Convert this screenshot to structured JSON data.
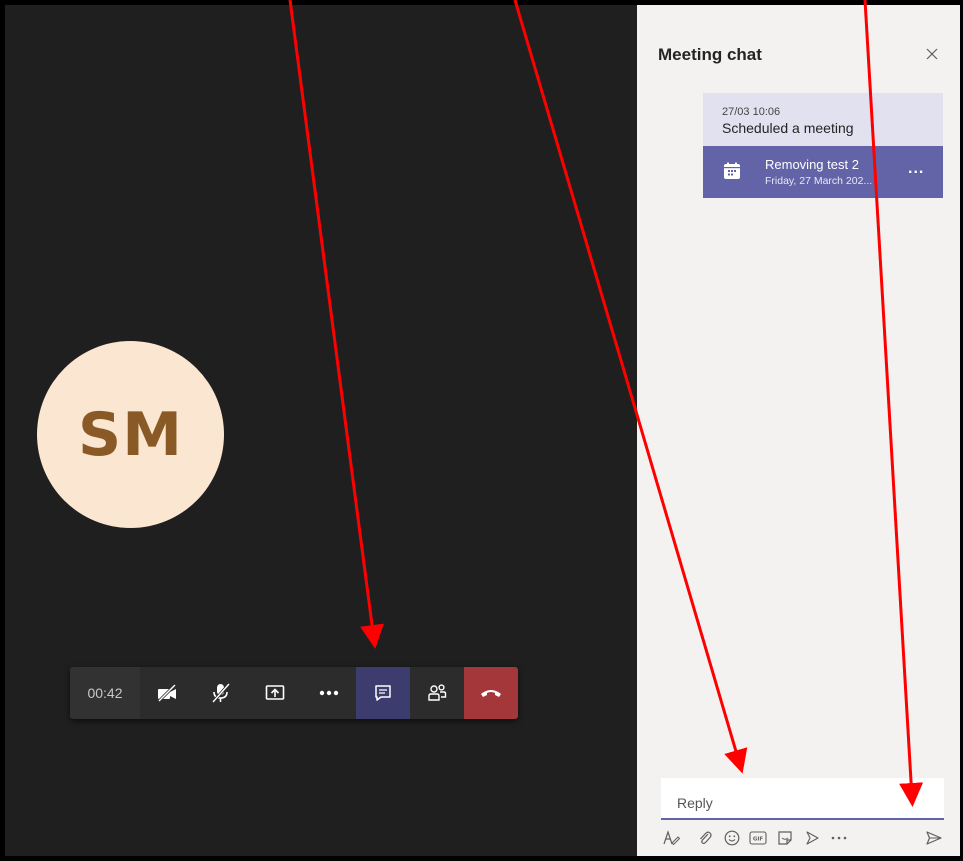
{
  "call": {
    "avatar_initials": "SM",
    "timer": "00:42",
    "buttons": [
      {
        "name": "camera-off-button",
        "icon": "video-off-icon"
      },
      {
        "name": "mic-muted-button",
        "icon": "mic-off-icon"
      },
      {
        "name": "share-button",
        "icon": "share-screen-icon"
      },
      {
        "name": "more-actions-button",
        "icon": "ellipsis-icon"
      },
      {
        "name": "chat-toggle-button",
        "icon": "chat-icon",
        "active": true
      },
      {
        "name": "participants-button",
        "icon": "people-icon"
      },
      {
        "name": "hang-up-button",
        "icon": "phone-hangup-icon"
      }
    ]
  },
  "chat": {
    "title": "Meeting chat",
    "message": {
      "time": "27/03 10:06",
      "text": "Scheduled a meeting",
      "meeting_title": "Removing test 2",
      "meeting_date": "Friday, 27 March 202...",
      "more": "..."
    },
    "reply_placeholder": "Reply",
    "tools": [
      "format-icon",
      "attach-icon",
      "emoji-icon",
      "gif-icon",
      "sticker-icon",
      "meet-now-icon",
      "more-options-icon",
      "send-icon"
    ]
  },
  "colors": {
    "accent": "#6264a7",
    "hangup": "#a4373a",
    "stage_bg": "#1f1f1f",
    "annotation_arrow": "#ff0000"
  }
}
